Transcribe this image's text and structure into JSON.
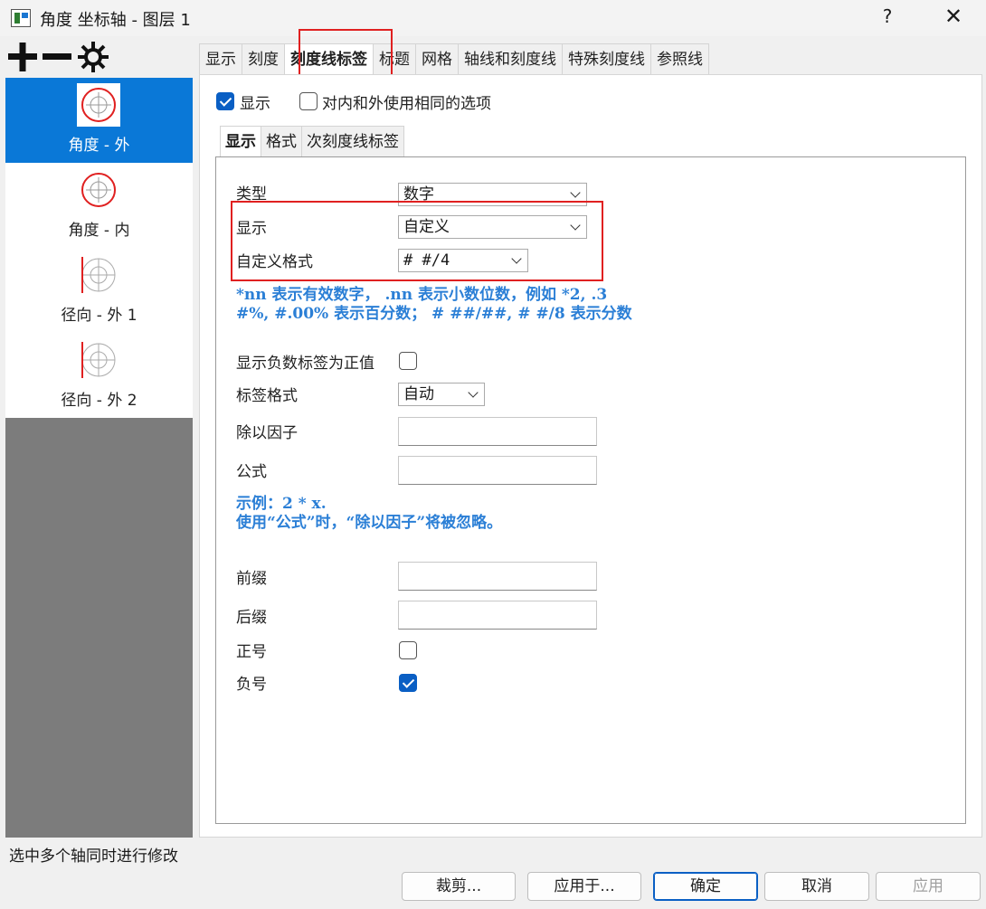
{
  "window": {
    "title": "角度 坐标轴 - 图层 1",
    "help_label": "?",
    "close_label": "✕"
  },
  "toolbar": {
    "add_icon": "plus-icon",
    "remove_icon": "minus-icon",
    "settings_icon": "gear-icon"
  },
  "tabs": [
    {
      "label": "显示"
    },
    {
      "label": "刻度"
    },
    {
      "label": "刻度线标签",
      "active": true
    },
    {
      "label": "标题"
    },
    {
      "label": "网格"
    },
    {
      "label": "轴线和刻度线"
    },
    {
      "label": "特殊刻度线"
    },
    {
      "label": "参照线"
    }
  ],
  "axes": [
    {
      "label": "角度 - 外",
      "icon": "polar-circle-red-icon",
      "selected": true
    },
    {
      "label": "角度 - 内",
      "icon": "polar-circle-red-icon"
    },
    {
      "label": "径向 - 外 1",
      "icon": "polar-radial-icon"
    },
    {
      "label": "径向 - 外 2",
      "icon": "polar-radial-icon"
    }
  ],
  "top_options": {
    "show_label": "显示",
    "show_checked": true,
    "same_options_label": "对内和外使用相同的选项",
    "same_options_checked": false
  },
  "subtabs": [
    {
      "label": "显示",
      "active": true
    },
    {
      "label": "格式"
    },
    {
      "label": "次刻度线标签"
    }
  ],
  "form": {
    "type_label": "类型",
    "type_value": "数字",
    "display_label": "显示",
    "display_value": "自定义",
    "custom_format_label": "自定义格式",
    "custom_format_value": "# #/4",
    "hint_line1": "*nn 表示有效数字， .nn 表示小数位数，例如 *2, .3",
    "hint_line2": "#%, #.00% 表示百分数； # ##/##, # #/8 表示分数",
    "negative_as_positive_label": "显示负数标签为正值",
    "negative_as_positive_checked": false,
    "label_format_label": "标签格式",
    "label_format_value": "自动",
    "divide_factor_label": "除以因子",
    "divide_factor_value": "",
    "formula_label": "公式",
    "formula_value": "",
    "formula_hint_line1": "示例：2 * x.",
    "formula_hint_line2": "使用“公式”时，“除以因子”将被忽略。",
    "prefix_label": "前缀",
    "prefix_value": "",
    "suffix_label": "后缀",
    "suffix_value": "",
    "plus_sign_label": "正号",
    "plus_sign_checked": false,
    "minus_sign_label": "负号",
    "minus_sign_checked": true
  },
  "status_text": "选中多个轴同时进行修改",
  "buttons": {
    "crop": "裁剪...",
    "apply_to": "应用于...",
    "ok": "确定",
    "cancel": "取消",
    "apply": "应用"
  },
  "colors": {
    "accent": "#0a78d7",
    "highlight": "#e02020",
    "hint": "#2b7fd6",
    "sidebar_gray": "#7c7c7c"
  }
}
